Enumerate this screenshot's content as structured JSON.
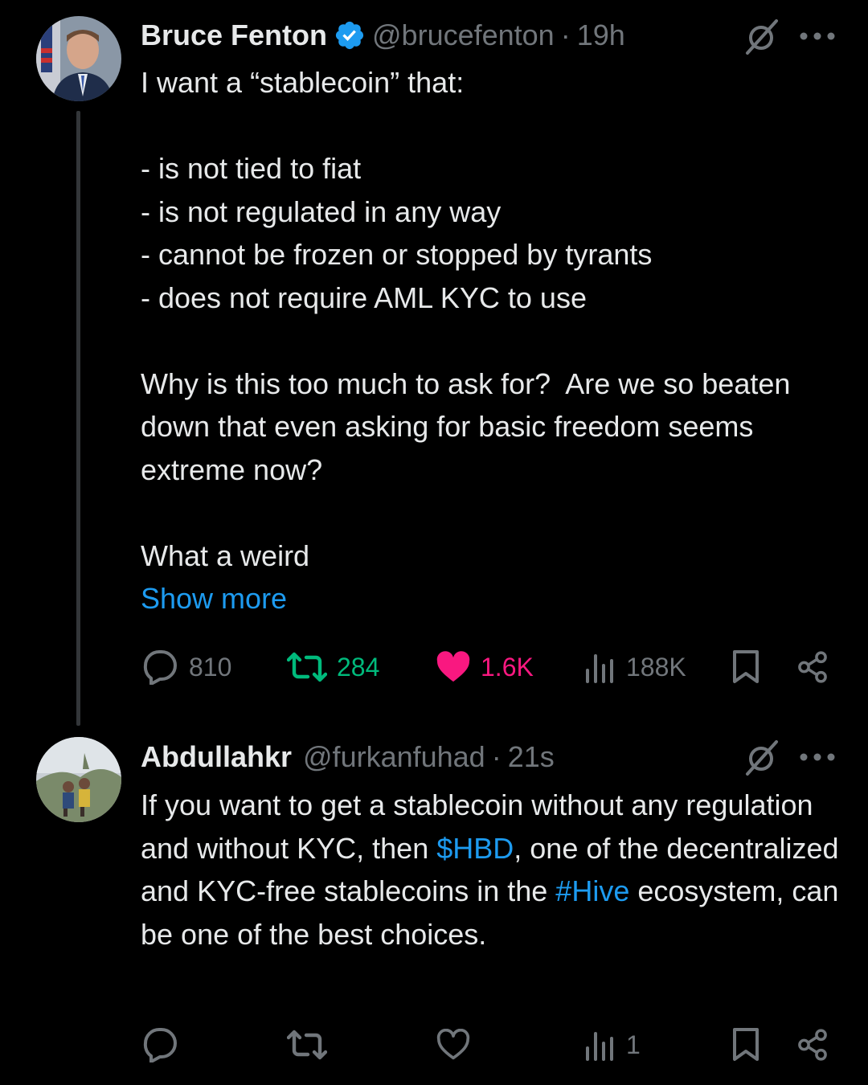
{
  "tweets": [
    {
      "author": "Bruce Fenton",
      "handle": "@brucefenton",
      "separator": "·",
      "time": "19h",
      "verified": true,
      "body": "I want a “stablecoin” that:\n\n- is not tied to fiat\n- is not regulated in any way\n- cannot be frozen or stopped by tyrants\n- does not require AML KYC to use\n\nWhy is this too much to ask for?  Are we so beaten down that even asking for basic freedom seems extreme now?\n\nWhat a weird",
      "show_more": "Show more",
      "stats": {
        "replies": "810",
        "reposts": "284",
        "likes": "1.6K",
        "views": "188K"
      },
      "icons": [
        "grok-icon",
        "more-icon",
        "reply-icon",
        "repost-icon",
        "like-filled-icon",
        "views-icon",
        "bookmark-icon",
        "share-icon"
      ]
    },
    {
      "author": "Abdullahkr",
      "handle": "@furkanfuhad",
      "separator": "·",
      "time": "21s",
      "body_parts": [
        "If you want to get a stablecoin without any regulation and without KYC, then ",
        "$HBD",
        ", one of the decentralized and KYC-free stablecoins in the ",
        "#Hive",
        " ecosystem, can be one of the best choices."
      ],
      "stats": {
        "replies": "",
        "reposts": "",
        "likes": "",
        "views": "1"
      },
      "icons": [
        "grok-icon",
        "more-icon",
        "reply-icon",
        "repost-icon",
        "like-icon",
        "views-icon",
        "bookmark-icon",
        "share-icon"
      ]
    }
  ],
  "colors": {
    "background": "#000000",
    "text": "#e7e9ea",
    "muted": "#71767b",
    "link": "#1d9bf0",
    "repost_active": "#00ba7c",
    "like_active": "#f91880"
  }
}
